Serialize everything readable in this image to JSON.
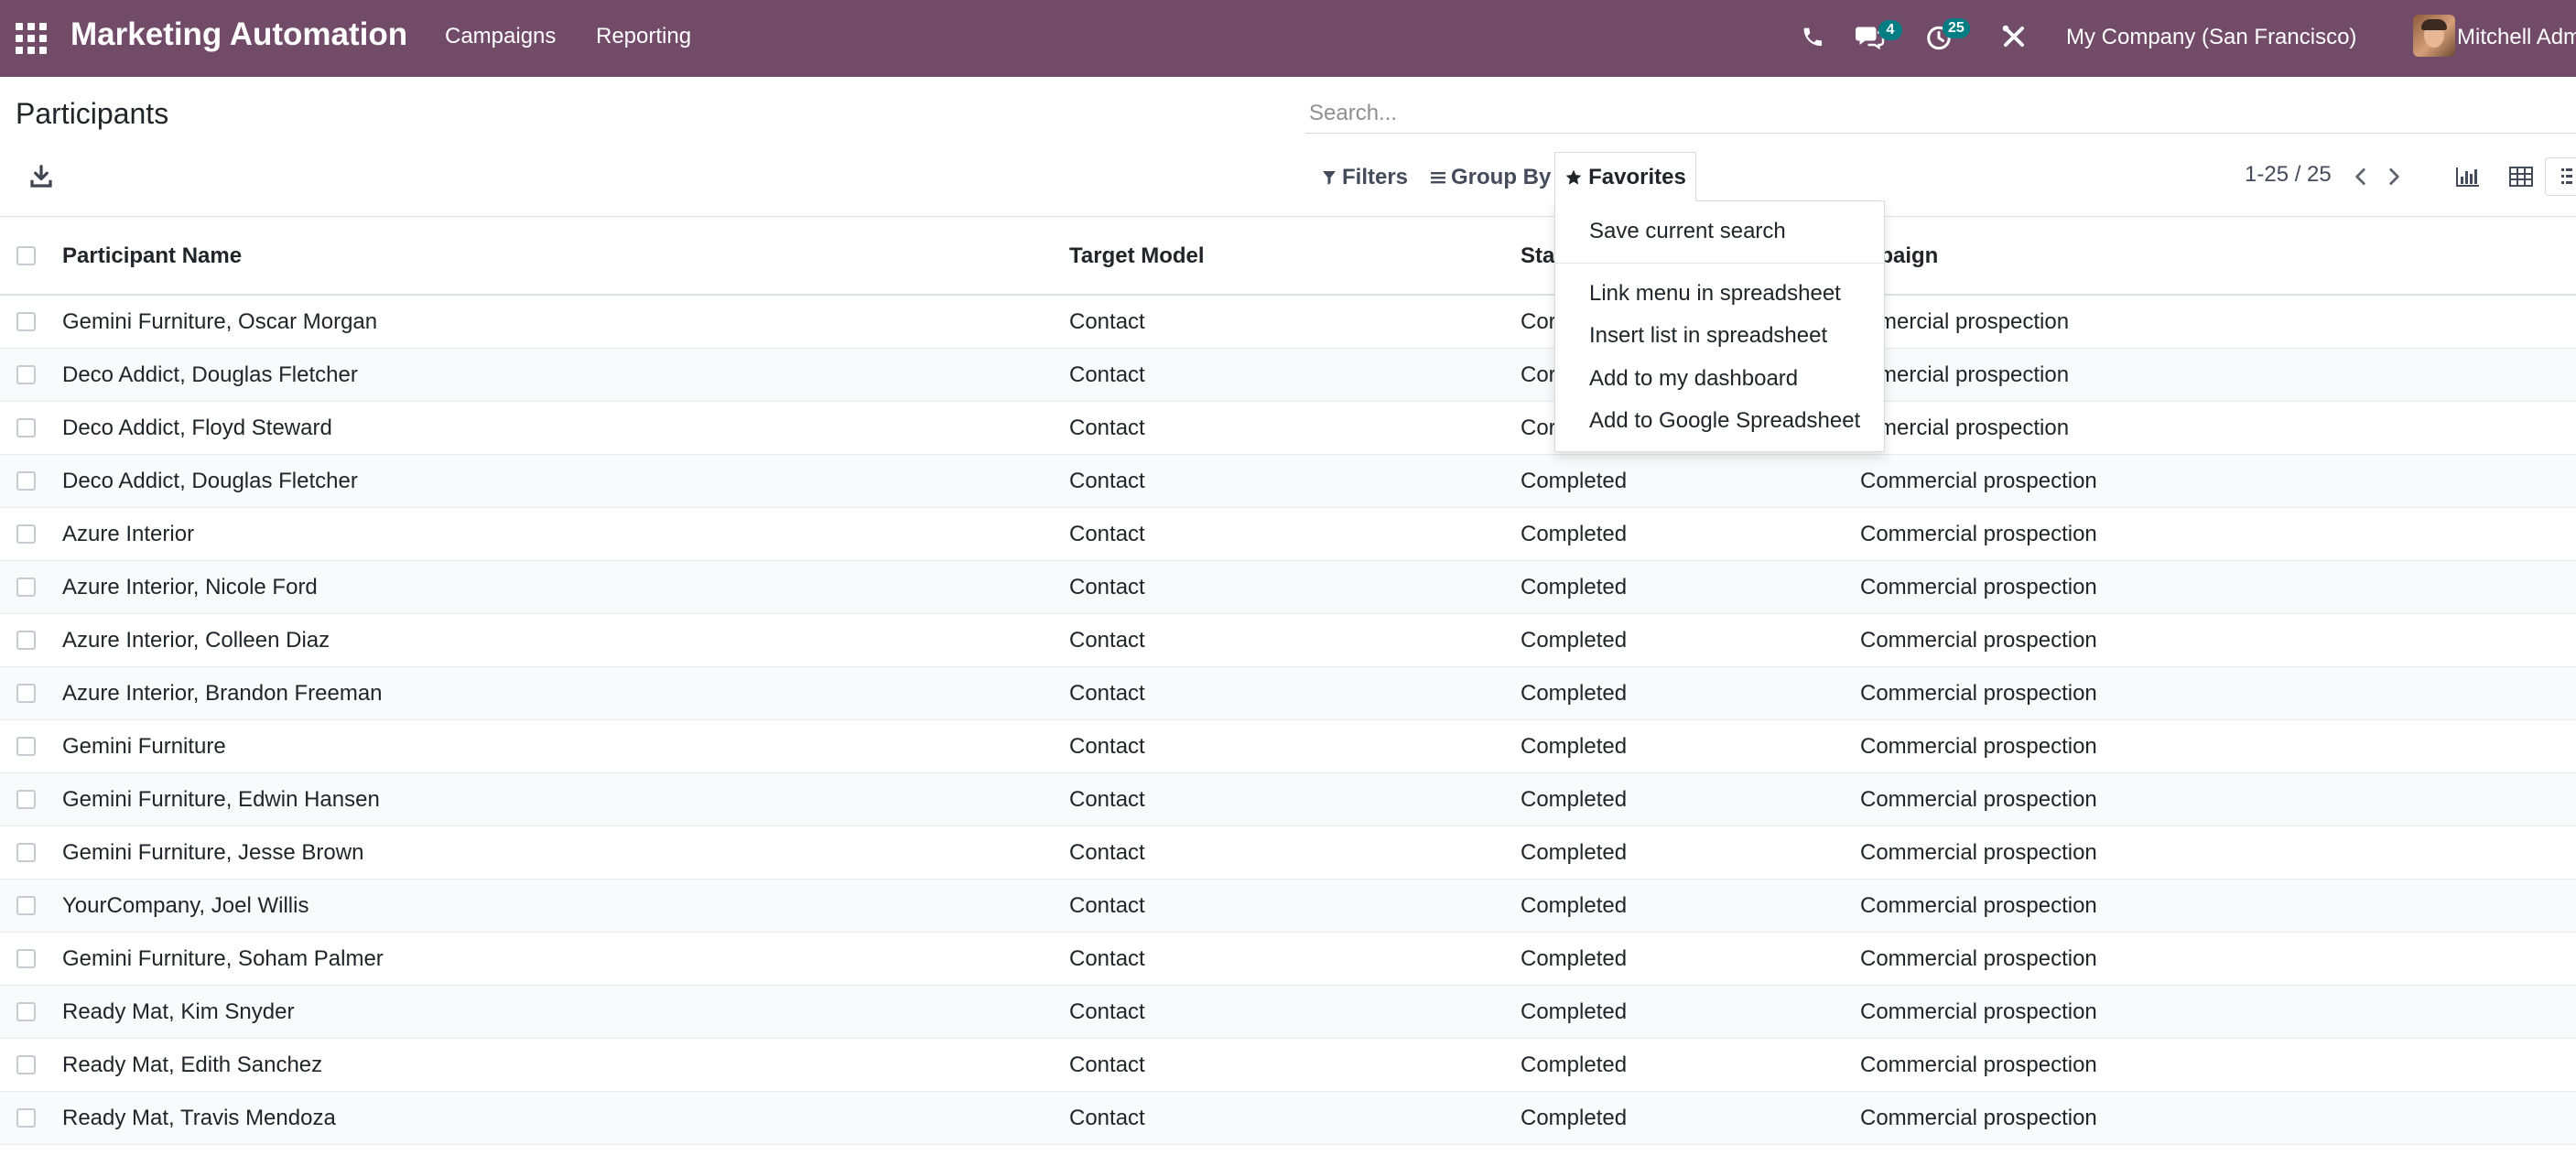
{
  "app": {
    "name": "Marketing Automation",
    "menus": [
      "Campaigns",
      "Reporting"
    ],
    "company": "My Company (San Francisco)",
    "user": "Mitchell Adm",
    "messages_badge": "4",
    "activities_badge": "25",
    "brand_color": "#714b67",
    "badge_color": "#017e84"
  },
  "control_panel": {
    "title": "Participants",
    "search_placeholder": "Search...",
    "filters_label": "Filters",
    "group_by_label": "Group By",
    "favorites_label": "Favorites",
    "pager": "1-25 / 25"
  },
  "favorites_menu": {
    "items": [
      "Save current search",
      "Link menu in spreadsheet",
      "Insert list in spreadsheet",
      "Add to my dashboard",
      "Add to Google Spreadsheet"
    ]
  },
  "table": {
    "columns": [
      "Participant Name",
      "Target Model",
      "Stat",
      "mpaign"
    ],
    "rows": [
      {
        "name": "Gemini Furniture, Oscar Morgan",
        "model": "Contact",
        "state": "Cor",
        "campaign": "mmercial prospection"
      },
      {
        "name": "Deco Addict, Douglas Fletcher",
        "model": "Contact",
        "state": "Cor",
        "campaign": "mmercial prospection"
      },
      {
        "name": "Deco Addict, Floyd Steward",
        "model": "Contact",
        "state": "Cor",
        "campaign": "mmercial prospection"
      },
      {
        "name": "Deco Addict, Douglas Fletcher",
        "model": "Contact",
        "state": "Completed",
        "campaign": "Commercial prospection"
      },
      {
        "name": "Azure Interior",
        "model": "Contact",
        "state": "Completed",
        "campaign": "Commercial prospection"
      },
      {
        "name": "Azure Interior, Nicole Ford",
        "model": "Contact",
        "state": "Completed",
        "campaign": "Commercial prospection"
      },
      {
        "name": "Azure Interior, Colleen Diaz",
        "model": "Contact",
        "state": "Completed",
        "campaign": "Commercial prospection"
      },
      {
        "name": "Azure Interior, Brandon Freeman",
        "model": "Contact",
        "state": "Completed",
        "campaign": "Commercial prospection"
      },
      {
        "name": "Gemini Furniture",
        "model": "Contact",
        "state": "Completed",
        "campaign": "Commercial prospection"
      },
      {
        "name": "Gemini Furniture, Edwin Hansen",
        "model": "Contact",
        "state": "Completed",
        "campaign": "Commercial prospection"
      },
      {
        "name": "Gemini Furniture, Jesse Brown",
        "model": "Contact",
        "state": "Completed",
        "campaign": "Commercial prospection"
      },
      {
        "name": "YourCompany, Joel Willis",
        "model": "Contact",
        "state": "Completed",
        "campaign": "Commercial prospection"
      },
      {
        "name": "Gemini Furniture, Soham Palmer",
        "model": "Contact",
        "state": "Completed",
        "campaign": "Commercial prospection"
      },
      {
        "name": "Ready Mat, Kim Snyder",
        "model": "Contact",
        "state": "Completed",
        "campaign": "Commercial prospection"
      },
      {
        "name": "Ready Mat, Edith Sanchez",
        "model": "Contact",
        "state": "Completed",
        "campaign": "Commercial prospection"
      },
      {
        "name": "Ready Mat, Travis Mendoza",
        "model": "Contact",
        "state": "Completed",
        "campaign": "Commercial prospection"
      }
    ]
  },
  "icons": [
    "apps-grid-icon",
    "phone-icon",
    "chat-icon",
    "clock-icon",
    "tools-icon",
    "download-icon",
    "filter-icon",
    "group-by-icon",
    "star-icon",
    "chevron-left-icon",
    "chevron-right-icon",
    "bar-chart-icon",
    "pivot-table-icon",
    "list-view-icon"
  ]
}
